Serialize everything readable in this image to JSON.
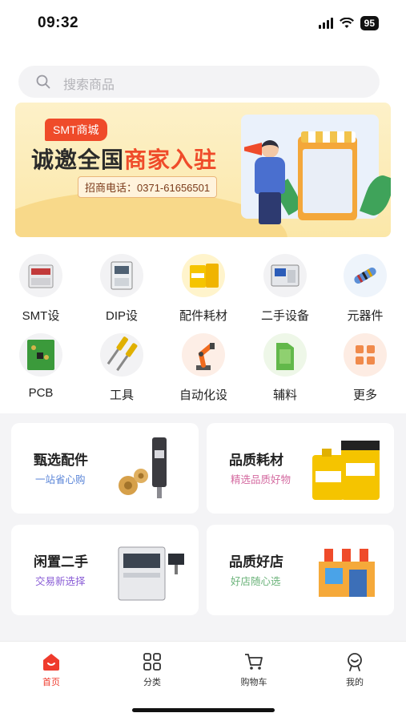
{
  "status": {
    "time": "09:32",
    "battery": "95"
  },
  "search": {
    "placeholder": "搜索商品"
  },
  "banner": {
    "tag": "SMT商城",
    "title_a": "诚邀全国",
    "title_b": "商家入驻",
    "phone": "招商电话：0371-61656501"
  },
  "categories": [
    {
      "label": "SMT设"
    },
    {
      "label": "DIP设"
    },
    {
      "label": "配件耗材"
    },
    {
      "label": "二手设备"
    },
    {
      "label": "元器件"
    },
    {
      "label": "PCB"
    },
    {
      "label": "工具"
    },
    {
      "label": "自动化设"
    },
    {
      "label": "辅料"
    },
    {
      "label": "更多"
    }
  ],
  "cards": [
    {
      "title": "甄选配件",
      "subtitle": "一站省心购",
      "sub_color": "#5b86d8"
    },
    {
      "title": "品质耗材",
      "subtitle": "精选品质好物",
      "sub_color": "#d46aa0"
    },
    {
      "title": "闲置二手",
      "subtitle": "交易新选择",
      "sub_color": "#8a5dd6"
    },
    {
      "title": "品质好店",
      "subtitle": "好店随心选",
      "sub_color": "#6bb37a"
    }
  ],
  "tabbar": [
    {
      "label": "首页",
      "active": true
    },
    {
      "label": "分类"
    },
    {
      "label": "购物车"
    },
    {
      "label": "我的"
    }
  ],
  "colors": {
    "accent": "#ef3b2d",
    "bg": "#f4f4f6"
  }
}
